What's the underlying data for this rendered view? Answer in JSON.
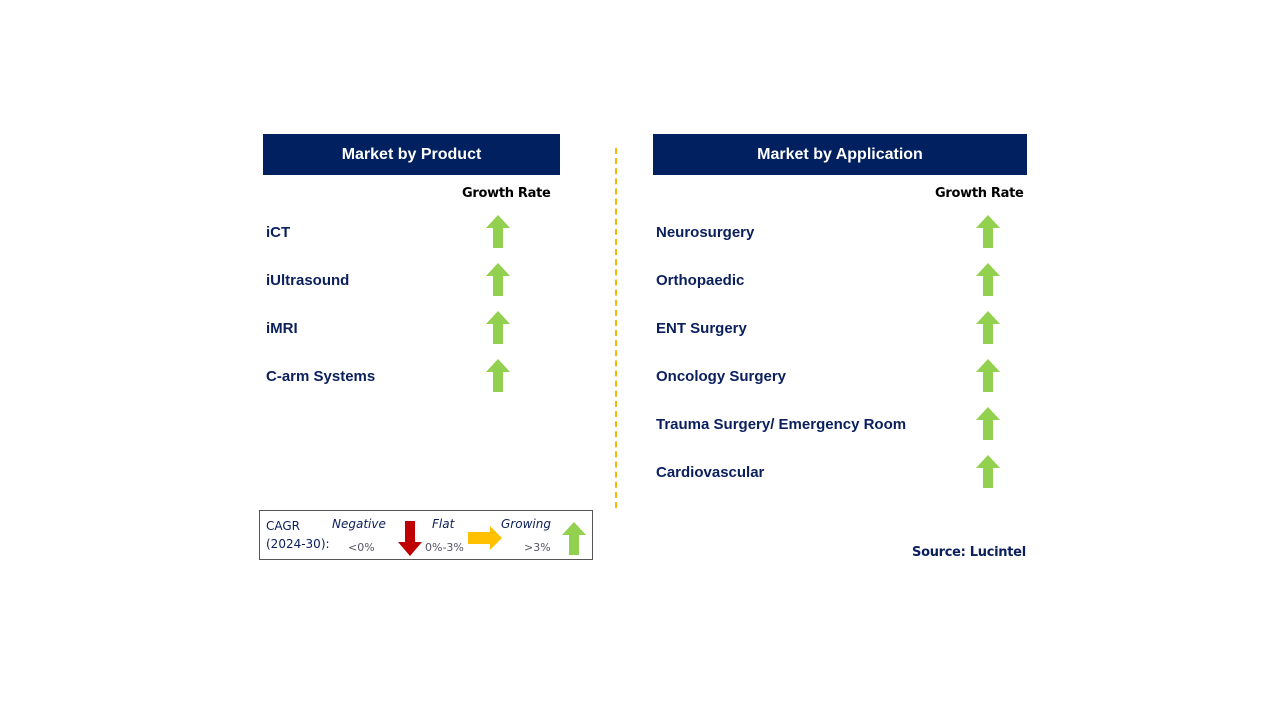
{
  "product": {
    "title": "Market by Product",
    "growth_label": "Growth Rate",
    "items": [
      {
        "label": "iCT",
        "trend": "growing"
      },
      {
        "label": "iUltrasound",
        "trend": "growing"
      },
      {
        "label": "iMRI",
        "trend": "growing"
      },
      {
        "label": "C-arm Systems",
        "trend": "growing"
      }
    ]
  },
  "application": {
    "title": "Market by Application",
    "growth_label": "Growth Rate",
    "items": [
      {
        "label": "Neurosurgery",
        "trend": "growing"
      },
      {
        "label": "Orthopaedic",
        "trend": "growing"
      },
      {
        "label": "ENT Surgery",
        "trend": "growing"
      },
      {
        "label": "Oncology Surgery",
        "trend": "growing"
      },
      {
        "label": "Trauma Surgery/ Emergency Room",
        "trend": "growing"
      },
      {
        "label": "Cardiovascular",
        "trend": "growing"
      }
    ]
  },
  "legend": {
    "cagr": "CAGR",
    "period": "(2024-30):",
    "negative": "Negative",
    "negative_range": "<0%",
    "flat": "Flat",
    "flat_range": "0%-3%",
    "growing": "Growing",
    "growing_range": ">3%"
  },
  "source": "Source: Lucintel",
  "colors": {
    "header": "#002060",
    "growing": "#92D050",
    "flat": "#FFC000",
    "negative": "#C00000",
    "divider": "#F5B800"
  }
}
